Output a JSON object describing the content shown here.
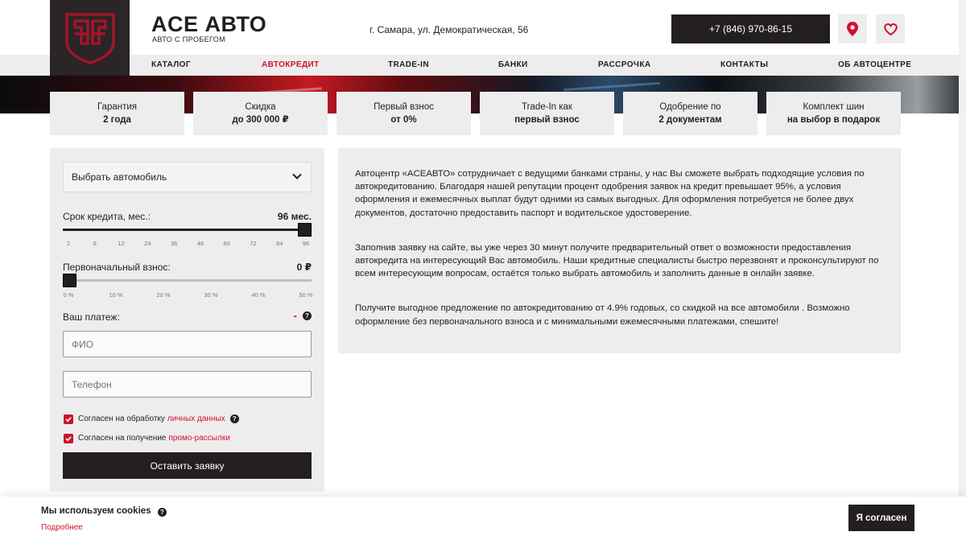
{
  "header": {
    "brand_title": "ACE АВТО",
    "brand_subtitle": "АВТО С ПРОБЕГОМ",
    "address": "г. Самара, ул. Демократическая, 56",
    "phone": "+7 (846) 970-86-15"
  },
  "nav": {
    "items": [
      {
        "label": "КАТАЛОГ"
      },
      {
        "label": "АВТОКРЕДИТ",
        "active": true
      },
      {
        "label": "TRADE-IN"
      },
      {
        "label": "БАНКИ"
      },
      {
        "label": "РАССРОЧКА"
      },
      {
        "label": "КОНТАКТЫ"
      },
      {
        "label": "ОБ АВТОЦЕНТРЕ"
      }
    ]
  },
  "benefits": [
    {
      "label": "Гарантия",
      "value": "2 года"
    },
    {
      "label": "Скидка",
      "value": "до 300 000 ₽"
    },
    {
      "label": "Первый взнос",
      "value": "от 0%"
    },
    {
      "label": "Trade-In как",
      "value": "первый взнос"
    },
    {
      "label": "Одобрение по",
      "value": "2 документам"
    },
    {
      "label": "Комплект шин",
      "value": "на выбор в подарок"
    }
  ],
  "form": {
    "select_car": "Выбрать автомобиль",
    "term_label": "Срок кредита, мес.:",
    "term_value": "96 мес.",
    "term_level": 1.0,
    "term_ticks": [
      "2",
      "6",
      "12",
      "24",
      "36",
      "48",
      "60",
      "72",
      "84",
      "96"
    ],
    "down_label": "Первоначальный взнос:",
    "down_value": "0 ₽",
    "down_level": 0.0,
    "down_ticks": [
      "0 %",
      "10 %",
      "20 %",
      "30 %",
      "40 %",
      "50 %"
    ],
    "payment_label": "Ваш платеж:",
    "payment_value": "-",
    "fio_placeholder": "ФИО",
    "phone_placeholder": "Телефон",
    "consent1_text": "Согласен на обработку",
    "consent1_link": "личных данных",
    "consent2_text": "Согласен на получение",
    "consent2_link": "промо-рассылки",
    "submit_label": "Оставить заявку"
  },
  "info": {
    "paragraphs": [
      "Автоцентр «ACEАВТО» сотрудничает с ведущими банками страны, у нас Вы сможете выбрать подходящие условия по автокредитованию. Благодаря нашей репутации процент одобрения заявок на кредит превышает 95%, а условия оформления и ежемесячных выплат будут одними из самых выгодных. Для оформления потребуется не более двух документов, достаточно предоставить паспорт и водительское удостоверение.",
      "Заполнив заявку на сайте, вы уже через 30 минут получите предварительный ответ о возможности предоставления автокредита на интересующий Вас автомобиль. Наши кредитные специалисты быстро перезвонят и проконсультируют по всем интересующим вопросам, остаётся только выбрать автомобиль и заполнить данные в онлайн заявке.",
      "Получите выгодное предложение по автокредитованию от 4.9% годовых, со скидкой на все автомобили . Возможно оформление без первоначального взноса и с минимальными ежемесячными платежами, спешите!"
    ]
  },
  "cookie": {
    "title": "Мы используем cookies",
    "more": "Подробнее",
    "accept": "Я согласен"
  },
  "colors": {
    "accent": "#d0112b",
    "dark": "#231f20",
    "panel": "#ededed"
  },
  "icons": [
    "logo-emblem-icon",
    "location-pin-icon",
    "heart-icon",
    "chevron-down-icon",
    "question-icon",
    "checkmark-icon"
  ]
}
